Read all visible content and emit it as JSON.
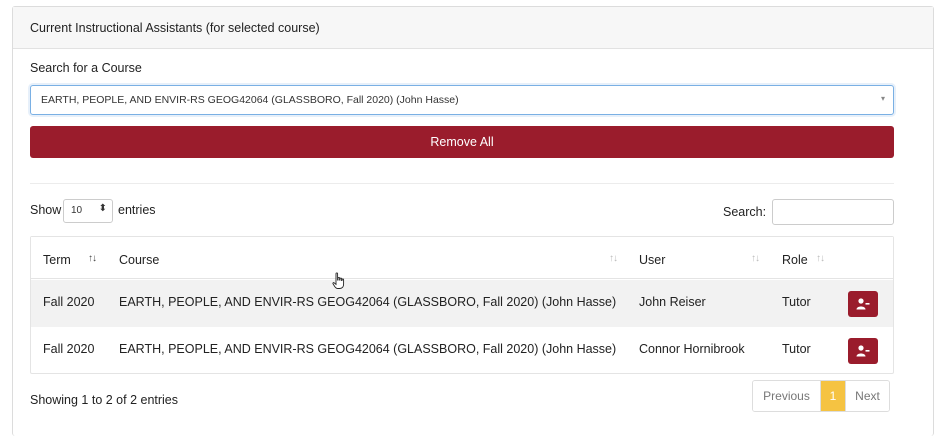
{
  "panel": {
    "title": "Current Instructional Assistants (for selected course)"
  },
  "course_search": {
    "label": "Search for a Course",
    "selected": "EARTH, PEOPLE, AND ENVIR-RS GEOG42064 (GLASSBORO, Fall 2020) (John Hasse)",
    "caret": "▾"
  },
  "remove_all_label": "Remove All",
  "table_controls": {
    "show_label": "Show",
    "page_length": "10",
    "page_length_caret": "⬍",
    "entries_label": "entries",
    "search_label": "Search:",
    "search_value": ""
  },
  "table": {
    "columns": [
      {
        "label": "Term",
        "sort": "↑↓"
      },
      {
        "label": "Course",
        "sort": "↑↓"
      },
      {
        "label": "User",
        "sort": "↑↓"
      },
      {
        "label": "Role",
        "sort": "↑↓"
      }
    ],
    "rows": [
      {
        "term": "Fall 2020",
        "course": "EARTH, PEOPLE, AND ENVIR-RS GEOG42064 (GLASSBORO, Fall 2020) (John Hasse)",
        "user": "John Reiser",
        "role": "Tutor",
        "action_icon": "remove-user-icon"
      },
      {
        "term": "Fall 2020",
        "course": "EARTH, PEOPLE, AND ENVIR-RS GEOG42064 (GLASSBORO, Fall 2020) (John Hasse)",
        "user": "Connor Hornibrook",
        "role": "Tutor",
        "action_icon": "remove-user-icon"
      }
    ]
  },
  "footer": {
    "info": "Showing 1 to 2 of 2 entries",
    "pagination": {
      "previous": "Previous",
      "current": "1",
      "next": "Next"
    }
  },
  "colors": {
    "primary": "#9a1c2c",
    "page_active": "#f5c342",
    "focus_border": "#7ab0e4"
  }
}
